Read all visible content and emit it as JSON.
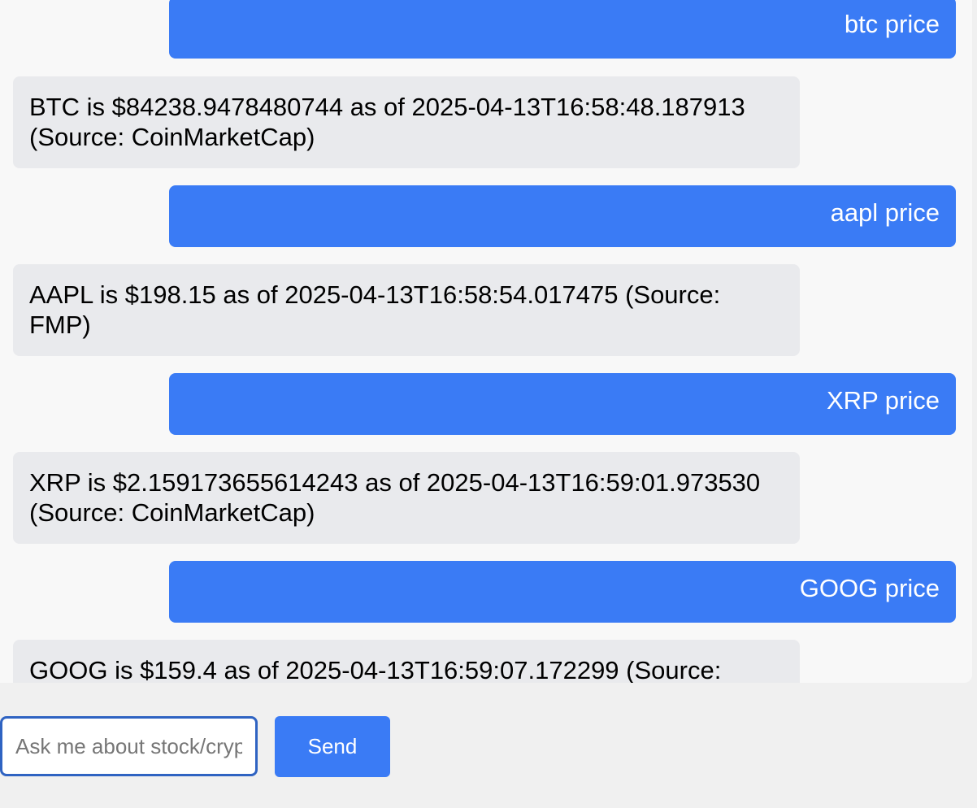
{
  "messages": [
    {
      "role": "user",
      "text": "btc price"
    },
    {
      "role": "bot",
      "text": "BTC is $84238.9478480744 as of 2025-04-13T16:58:48.187913 (Source: CoinMarketCap)"
    },
    {
      "role": "user",
      "text": "aapl price"
    },
    {
      "role": "bot",
      "text": "AAPL is $198.15 as of 2025-04-13T16:58:54.017475 (Source: FMP)"
    },
    {
      "role": "user",
      "text": "XRP price"
    },
    {
      "role": "bot",
      "text": "XRP is $2.159173655614243 as of 2025-04-13T16:59:01.973530 (Source: CoinMarketCap)"
    },
    {
      "role": "user",
      "text": "GOOG price"
    },
    {
      "role": "bot",
      "text": "GOOG is $159.4 as of 2025-04-13T16:59:07.172299 (Source:"
    }
  ],
  "input": {
    "placeholder": "Ask me about stock/crypto prices...",
    "value": ""
  },
  "send_button": {
    "label": "Send"
  },
  "colors": {
    "user_bubble": "#3a7bf5",
    "bot_bubble": "#e9eaed",
    "chat_background": "#f8f8f8",
    "page_background": "#f0f0f0",
    "input_border": "#2f63c2"
  }
}
